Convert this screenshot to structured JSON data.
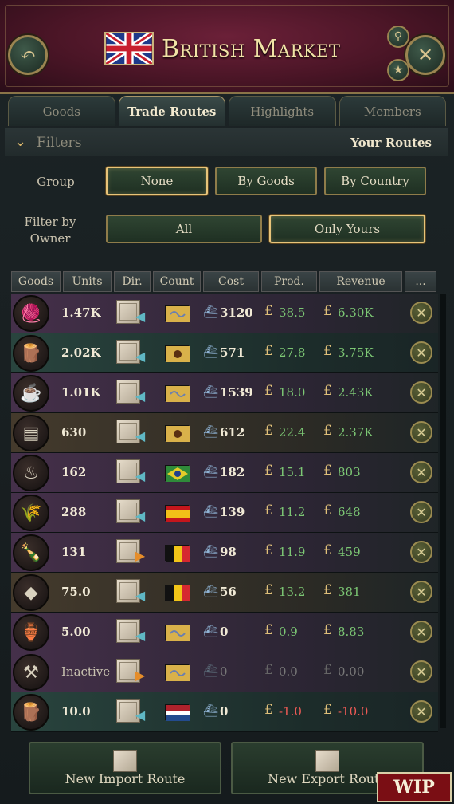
{
  "header": {
    "title": "British Market",
    "back_icon": "undo-arrow-icon",
    "close_icon": "close-icon",
    "search_icon": "magnifier-icon",
    "star_icon": "star-icon"
  },
  "tabs": [
    {
      "label": "Goods",
      "active": false
    },
    {
      "label": "Trade Routes",
      "active": true
    },
    {
      "label": "Highlights",
      "active": false
    },
    {
      "label": "Members",
      "active": false
    }
  ],
  "filters": {
    "label": "Filters",
    "your_routes": "Your Routes",
    "group_label": "Group",
    "group_options": [
      "None",
      "By Goods",
      "By Country"
    ],
    "group_selected": "None",
    "owner_label": "Filter by Owner",
    "owner_options": [
      "All",
      "Only Yours"
    ],
    "owner_selected": "Only Yours"
  },
  "table": {
    "columns": [
      "Goods",
      "Units",
      "Dir.",
      "Count",
      "Cost",
      "Prod.",
      "Revenue",
      "..."
    ],
    "rows": [
      {
        "good": "dye",
        "icon": "dye-icon",
        "bg": "purple",
        "units": "1.47K",
        "dir": "import",
        "country": "gold",
        "cost": "3120",
        "prod": "38.5",
        "revenue": "6.30K",
        "prod_sign": "pos",
        "active": true
      },
      {
        "good": "hardwood",
        "icon": "wood-logs-icon",
        "bg": "teal",
        "units": "2.02K",
        "dir": "import",
        "country": "gold-eagle",
        "cost": "571",
        "prod": "27.8",
        "revenue": "3.75K",
        "prod_sign": "pos",
        "active": true
      },
      {
        "good": "tea",
        "icon": "tea-cup-icon",
        "bg": "purple",
        "units": "1.01K",
        "dir": "import",
        "country": "gold",
        "cost": "1539",
        "prod": "18.0",
        "revenue": "2.43K",
        "prod_sign": "pos",
        "active": true
      },
      {
        "good": "lumber",
        "icon": "planks-icon",
        "bg": "brown",
        "units": "630",
        "dir": "import",
        "country": "gold-eagle",
        "cost": "612",
        "prod": "22.4",
        "revenue": "2.37K",
        "prod_sign": "pos",
        "active": true
      },
      {
        "good": "coffee",
        "icon": "coffee-pot-icon",
        "bg": "purple",
        "units": "162",
        "dir": "import",
        "country": "brazil",
        "cost": "182",
        "prod": "15.1",
        "revenue": "803",
        "prod_sign": "pos",
        "active": true
      },
      {
        "good": "grain",
        "icon": "grain-sack-icon",
        "bg": "purple",
        "units": "288",
        "dir": "import",
        "country": "spain",
        "cost": "139",
        "prod": "11.2",
        "revenue": "648",
        "prod_sign": "pos",
        "active": true
      },
      {
        "good": "liquor",
        "icon": "liquor-bottles-icon",
        "bg": "purple",
        "units": "131",
        "dir": "export",
        "country": "belgium",
        "cost": "98",
        "prod": "11.9",
        "revenue": "459",
        "prod_sign": "pos",
        "active": true
      },
      {
        "good": "iron",
        "icon": "iron-ore-icon",
        "bg": "brown",
        "units": "75.0",
        "dir": "import",
        "country": "belgium",
        "cost": "56",
        "prod": "13.2",
        "revenue": "381",
        "prod_sign": "pos",
        "active": true
      },
      {
        "good": "porcelain",
        "icon": "porcelain-vase-icon",
        "bg": "purple",
        "units": "5.00",
        "dir": "import",
        "country": "gold",
        "cost": "0",
        "prod": "0.9",
        "revenue": "8.83",
        "prod_sign": "pos",
        "active": true
      },
      {
        "good": "tools",
        "icon": "tools-icon",
        "bg": "purple",
        "units": "Inactive",
        "dir": "export",
        "country": "gold",
        "cost": "0",
        "prod": "0.0",
        "revenue": "0.00",
        "prod_sign": "dim",
        "active": false
      },
      {
        "good": "hardwood",
        "icon": "wood-logs-icon",
        "bg": "teal",
        "units": "10.0",
        "dir": "import",
        "country": "netherlands",
        "cost": "0",
        "prod": "-1.0",
        "revenue": "-10.0",
        "prod_sign": "neg",
        "active": true
      }
    ]
  },
  "buttons": {
    "new_import": "New Import Route",
    "new_export": "New Export Route"
  },
  "badge": {
    "wip": "WIP"
  },
  "currency_symbol": "£"
}
